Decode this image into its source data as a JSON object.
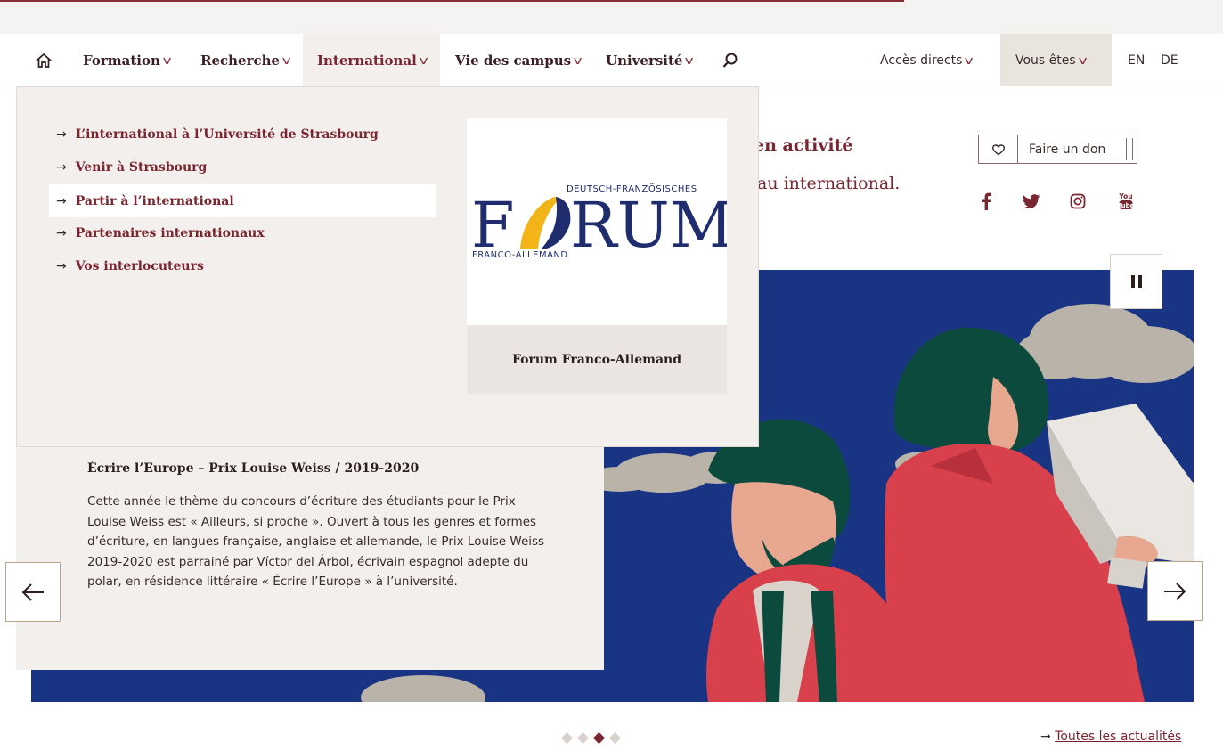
{
  "nav": {
    "home_icon": "home-icon",
    "items": [
      {
        "label": "Formation"
      },
      {
        "label": "Recherche"
      },
      {
        "label": "International"
      },
      {
        "label": "Vie des campus"
      },
      {
        "label": "Université"
      }
    ],
    "search_icon": "search-icon",
    "direct_access": "Accès directs",
    "you_are": "Vous êtes",
    "lang_en": "EN",
    "lang_de": "DE"
  },
  "dropdown": {
    "links": [
      "L’international à l’Université de Strasbourg",
      "Venir à Strasbourg",
      "Partir à l’international",
      "Partenaires internationaux",
      "Vos interlocuteurs"
    ],
    "card_title": "Forum Franco-Allemand",
    "logo": {
      "word_f": "F",
      "word_rum": "RUM",
      "top_text": "DEUTSCH-FRANZÖSISCHES",
      "bottom_text": "FRANCO-ALLEMAND"
    }
  },
  "hero": {
    "partial_line1": "en activité",
    "partial_line2": "au international."
  },
  "donate": {
    "label": "Faire un don",
    "icon": "heart-icon"
  },
  "social": [
    "facebook-icon",
    "twitter-icon",
    "instagram-icon",
    "youtube-icon"
  ],
  "slide": {
    "title": "Écrire l’Europe – Prix Louise Weiss / 2019-2020",
    "body": "Cette année le thème du concours d’écriture des étudiants pour le Prix Louise Weiss est « Ailleurs, si proche ». Ouvert à tous les genres et formes d’écriture, en langues française, anglaise et allemande, le Prix Louise Weiss 2019-2020 est parrainé par Víctor del Árbol, écrivain espagnol adepte du polar, en résidence littéraire « Écrire l’Europe » à l’université.",
    "dots_total": 4,
    "active_dot": 3
  },
  "footer": {
    "all_news": "Toutes les actualités"
  },
  "colors": {
    "brand": "#7a2630",
    "slide_bg": "#1e3a8a",
    "panel": "#f3efec"
  }
}
